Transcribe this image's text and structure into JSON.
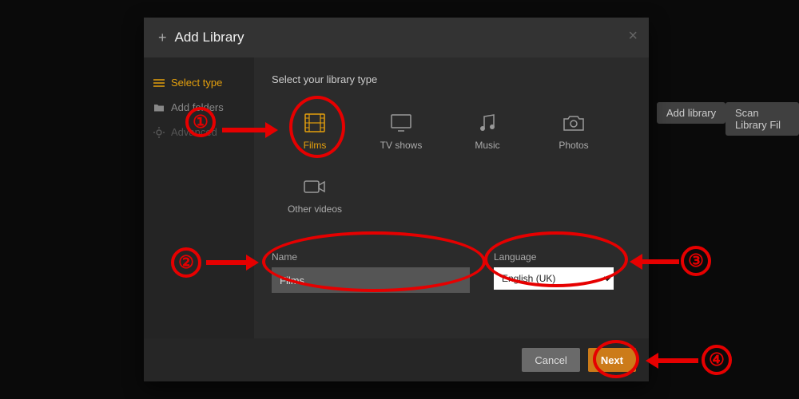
{
  "bg": {
    "add_library": "Add library",
    "scan_library": "Scan Library Fil"
  },
  "modal": {
    "title": "Add Library",
    "close": "×",
    "sidebar": {
      "select_type": "Select type",
      "add_folders": "Add folders",
      "advanced": "Advanced"
    },
    "heading": "Select your library type",
    "types": {
      "films": "Films",
      "tv": "TV shows",
      "music": "Music",
      "photos": "Photos",
      "other": "Other videos"
    },
    "name_label": "Name",
    "name_value": "Films",
    "language_label": "Language",
    "language_value": "English (UK)",
    "cancel": "Cancel",
    "next": "Next"
  },
  "annotations": {
    "n1": "①",
    "n2": "②",
    "n3": "③",
    "n4": "④"
  }
}
